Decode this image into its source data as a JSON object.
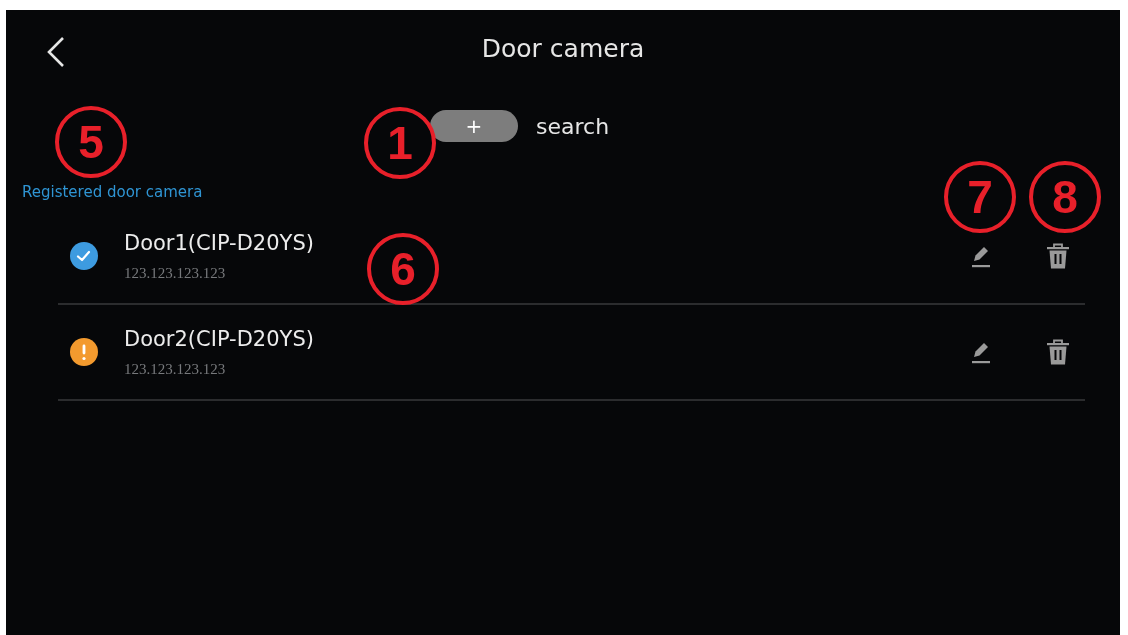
{
  "header": {
    "title": "Door camera"
  },
  "add_button": {
    "label": "+",
    "caption": "search",
    "callout": "1"
  },
  "section": {
    "label": "Registered door camera",
    "callout": "5"
  },
  "rows": [
    {
      "name": "Door1(CIP-D20YS)",
      "address": "123.123.123.123",
      "kind": "ok",
      "callout": "6",
      "edit_callout": "7",
      "delete_callout": "8"
    },
    {
      "name": "Door2(CIP-D20YS)",
      "address": "123.123.123.123",
      "kind": "warning"
    }
  ]
}
